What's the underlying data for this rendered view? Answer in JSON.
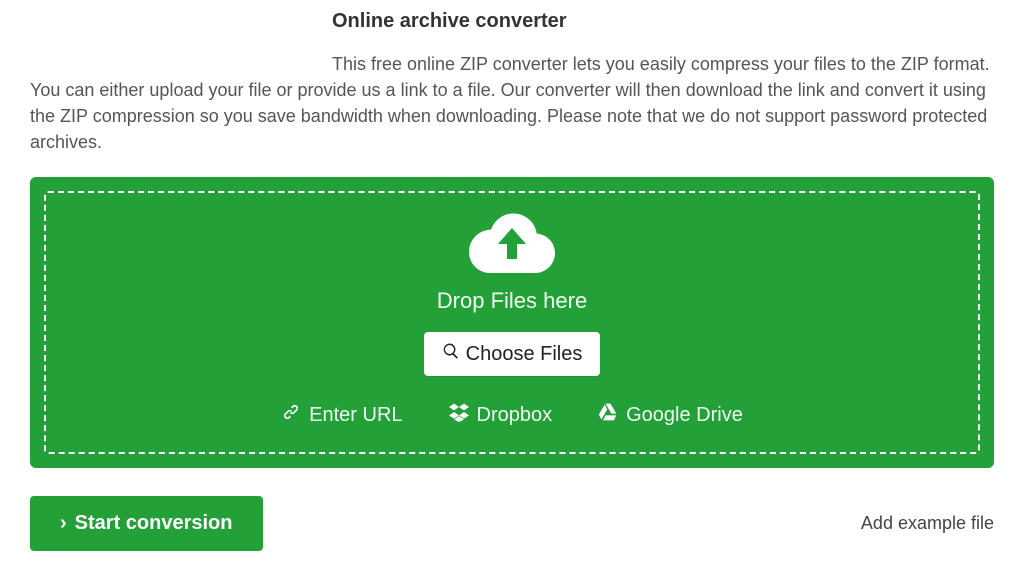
{
  "title": "Online archive converter",
  "description": "This free online ZIP converter lets you easily compress your files to the ZIP format. You can either upload your file or provide us a link to a file. Our converter will then download the link and convert it using the ZIP compression so you save bandwidth when downloading. Please note that we do not support password protected archives.",
  "dropzone": {
    "drop_label": "Drop Files here",
    "choose_button": "Choose Files",
    "sources": {
      "url": "Enter URL",
      "dropbox": "Dropbox",
      "gdrive": "Google Drive"
    }
  },
  "actions": {
    "start": "Start conversion",
    "add_example": "Add example file"
  },
  "colors": {
    "accent": "#23a038"
  }
}
